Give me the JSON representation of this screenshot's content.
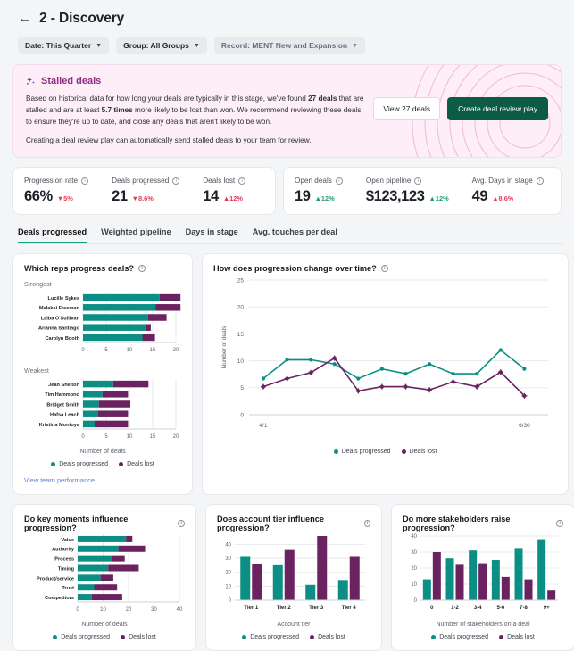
{
  "colors": {
    "teal": "#0b8f84",
    "purple": "#6b2260",
    "green": "#18a07e",
    "banner_pink": "#fdeef7",
    "link_blue": "#5b7fd4"
  },
  "header": {
    "back_icon": "arrow-left-icon",
    "title": "2 - Discovery",
    "filters": [
      {
        "label": "Date: This Quarter",
        "muted": false
      },
      {
        "label": "Group: All Groups",
        "muted": false
      },
      {
        "label": "Record: MENT New and Expansion",
        "muted": true
      }
    ]
  },
  "banner": {
    "icon": "sparkle-icon",
    "title": "Stalled deals",
    "paragraph_1_pre": "Based on historical data for how long your deals are typically in this stage, we've found ",
    "paragraph_1_b1": "27 deals",
    "paragraph_1_mid": " that are stalled and are at least ",
    "paragraph_1_b2": "5.7 times",
    "paragraph_1_post": " more likely to be lost than won. We recommend reviewing these deals to ensure they're up to date, and close any deals that aren't likely to be won.",
    "paragraph_2": "Creating a deal review play can automatically send stalled deals to your team for review.",
    "btn_view": "View 27 deals",
    "btn_create": "Create deal review play"
  },
  "kpis": {
    "left": [
      {
        "label": "Progression rate",
        "value": "66%",
        "delta": "5%",
        "dir": "down"
      },
      {
        "label": "Deals progressed",
        "value": "21",
        "delta": "8.6%",
        "dir": "down"
      },
      {
        "label": "Deals lost",
        "value": "14",
        "delta": "12%",
        "dir": "up-bad"
      }
    ],
    "right": [
      {
        "label": "Open deals",
        "value": "19",
        "delta": "12%",
        "dir": "up-good"
      },
      {
        "label": "Open pipeline",
        "value": "$123,123",
        "delta": "12%",
        "dir": "up-good"
      },
      {
        "label": "Avg. Days in stage",
        "value": "49",
        "delta": "8.6%",
        "dir": "up-bad"
      }
    ]
  },
  "tabs": [
    {
      "label": "Deals progressed",
      "active": true
    },
    {
      "label": "Weighted pipeline",
      "active": false
    },
    {
      "label": "Days in stage",
      "active": false
    },
    {
      "label": "Avg. touches per deal",
      "active": false
    }
  ],
  "legend": {
    "progressed": "Deals progressed",
    "lost": "Deals lost"
  },
  "reps_card": {
    "title": "Which reps progress deals?",
    "info_icon": "info-icon",
    "strongest_label": "Strongest",
    "weakest_label": "Weakest",
    "link": "View team performance"
  },
  "chart_data": [
    {
      "id": "reps-strongest",
      "type": "bar",
      "orientation": "horizontal",
      "stacked": true,
      "title": "Which reps progress deals? — Strongest",
      "xlabel": "Number of deals",
      "ylabel": "",
      "xlim": [
        0,
        20
      ],
      "xticks": [
        0,
        5,
        10,
        15,
        20
      ],
      "categories": [
        "Lucille Sykes",
        "Malakai Freeman",
        "Laiba O'Sullivan",
        "Arianna Santiago",
        "Carolyn Booth"
      ],
      "series": [
        {
          "name": "Deals progressed",
          "color": "#0b8f84",
          "values": [
            16.5,
            15.6,
            14.0,
            13.4,
            12.8
          ]
        },
        {
          "name": "Deals lost",
          "color": "#6b2260",
          "values": [
            4.5,
            5.4,
            4.0,
            1.2,
            2.7
          ]
        }
      ],
      "grid": true
    },
    {
      "id": "reps-weakest",
      "type": "bar",
      "orientation": "horizontal",
      "stacked": true,
      "title": "Which reps progress deals? — Weakest",
      "xlabel": "Number of deals",
      "xlim": [
        0,
        20
      ],
      "xticks": [
        0,
        5,
        10,
        15,
        20
      ],
      "categories": [
        "Jean Shelton",
        "Tim Hammond",
        "Bridget Smith",
        "Hafsa Leach",
        "Kristina Montoya"
      ],
      "series": [
        {
          "name": "Deals progressed",
          "color": "#0b8f84",
          "values": [
            6.5,
            4.2,
            3.4,
            3.2,
            2.5
          ]
        },
        {
          "name": "Deals lost",
          "color": "#6b2260",
          "values": [
            7.6,
            5.5,
            6.8,
            6.5,
            7.2
          ]
        }
      ],
      "grid": true
    },
    {
      "id": "progression-over-time",
      "type": "line",
      "title": "How does progression change over time?",
      "xlabel": "",
      "ylabel": "Number of deals",
      "ylim": [
        0,
        25
      ],
      "yticks": [
        0,
        5,
        10,
        15,
        20,
        25
      ],
      "xticks": [
        "4/1",
        "6/30"
      ],
      "x": [
        1,
        2,
        3,
        4,
        5,
        6,
        7,
        8,
        9,
        10,
        11,
        12
      ],
      "series": [
        {
          "name": "Deals progressed",
          "color": "#0b8f84",
          "values": [
            6.7,
            10.2,
            10.2,
            9.4,
            6.7,
            8.5,
            7.6,
            9.4,
            7.6,
            7.6,
            12.0,
            8.5
          ]
        },
        {
          "name": "Deals lost",
          "color": "#6b2260",
          "values": [
            5.2,
            6.7,
            7.8,
            10.5,
            4.4,
            5.2,
            5.2,
            4.6,
            6.1,
            5.2,
            7.9,
            3.5
          ]
        }
      ],
      "grid": true,
      "legend_position": "bottom"
    },
    {
      "id": "key-moments",
      "type": "bar",
      "orientation": "horizontal",
      "stacked": true,
      "title": "Do key moments influence progression?",
      "xlabel": "Number of deals",
      "xlim": [
        0,
        40
      ],
      "xticks": [
        0,
        10,
        20,
        30,
        40
      ],
      "categories": [
        "Value",
        "Authority",
        "Process",
        "Timing",
        "Product/service",
        "Trust",
        "Competitors"
      ],
      "series": [
        {
          "name": "Deals progressed",
          "color": "#0b8f84",
          "values": [
            19.0,
            16.0,
            13.5,
            12.0,
            9.0,
            6.5,
            5.5
          ]
        },
        {
          "name": "Deals lost",
          "color": "#6b2260",
          "values": [
            2.5,
            10.5,
            5.0,
            12.0,
            5.0,
            9.0,
            12.0
          ]
        }
      ],
      "grid": true
    },
    {
      "id": "account-tier",
      "type": "bar",
      "orientation": "vertical",
      "stacked": false,
      "title": "Does account tier influence progression?",
      "xlabel": "Account tier",
      "ylabel": "",
      "ylim": [
        0,
        46
      ],
      "yticks": [
        0,
        10,
        20,
        30,
        40
      ],
      "categories": [
        "Tier 1",
        "Tier 2",
        "Tier 3",
        "Tier 4"
      ],
      "series": [
        {
          "name": "Deals progressed",
          "color": "#0b8f84",
          "values": [
            31,
            25,
            11,
            14.5
          ]
        },
        {
          "name": "Deals lost",
          "color": "#6b2260",
          "values": [
            26,
            36,
            46,
            31
          ]
        }
      ],
      "grid": true
    },
    {
      "id": "stakeholders",
      "type": "bar",
      "orientation": "vertical",
      "stacked": false,
      "title": "Do more stakeholders raise progression?",
      "xlabel": "Number of stakeholders on a deal",
      "ylabel": "",
      "ylim": [
        0,
        40
      ],
      "yticks": [
        0,
        10,
        20,
        30,
        40
      ],
      "categories": [
        "0",
        "1-2",
        "3-4",
        "5-6",
        "7-8",
        "9+"
      ],
      "series": [
        {
          "name": "Deals progressed",
          "color": "#0b8f84",
          "values": [
            13,
            26,
            31,
            25,
            32,
            38
          ]
        },
        {
          "name": "Deals lost",
          "color": "#6b2260",
          "values": [
            30,
            22,
            23,
            14.5,
            13,
            6
          ]
        }
      ],
      "grid": true
    }
  ]
}
